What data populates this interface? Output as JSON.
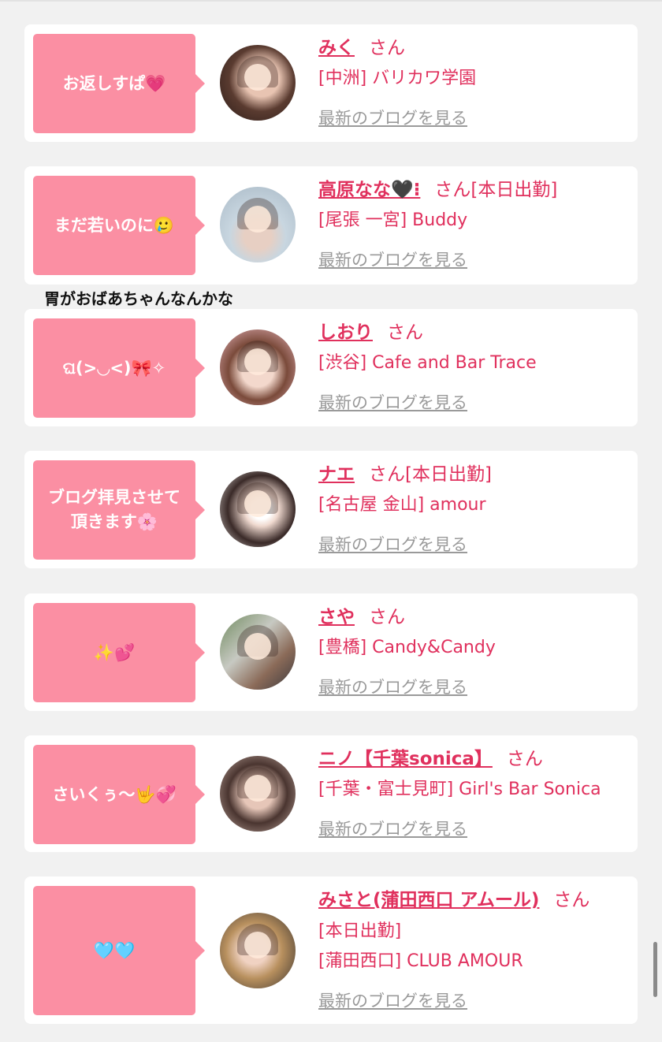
{
  "caption": "胃がおばあちゃんなんかな",
  "blog_link_label": "最新のブログを見る",
  "san_label": "さん",
  "colors": {
    "bubble": "#fb8fa3",
    "accent": "#e0305d",
    "link": "#9a9a9a",
    "background": "#f1f1f1"
  },
  "cards": [
    {
      "bubble": "お返しすぱ💗",
      "name": "みく",
      "suffix": "",
      "line1": "[中洲] バリカワ学園",
      "line2": "",
      "avatar": "portrait-with-glasses"
    },
    {
      "bubble": "まだ若いのに🥲",
      "name": "高原なな🖤⁝",
      "suffix": "[本日出勤]",
      "line1": "[尾張 一宮] Buddy",
      "line2": "",
      "avatar": "portrait-window"
    },
    {
      "bubble": "ଘ(>◡<)🎀✧",
      "name": "しおり",
      "suffix": "",
      "line1": "[渋谷] Cafe and Bar Trace",
      "line2": "",
      "avatar": "portrait-hearts"
    },
    {
      "bubble": "ブログ拝見させて\n頂きます🌸",
      "name": "ナエ",
      "suffix": "[本日出勤]",
      "line1": "[名古屋 金山] amour",
      "line2": "",
      "avatar": "portrait-sticker"
    },
    {
      "bubble": "✨💕",
      "name": "さや",
      "suffix": "",
      "line1": "[豊橋] Candy&Candy",
      "line2": "",
      "avatar": "portrait-window-seat"
    },
    {
      "bubble": "さいくぅ〜🤟💞",
      "name": "ニノ【千葉sonica】",
      "suffix": "",
      "line1": "[千葉・富士見町] Girl's Bar Sonica",
      "line2": "",
      "avatar": "portrait-blurred"
    },
    {
      "bubble": "🩵🩵",
      "name": "みさと(蒲田西口 アムール)",
      "suffix": "",
      "line1": "[本日出勤]",
      "line2": "[蒲田西口] CLUB AMOUR",
      "avatar": "portrait-hair"
    }
  ]
}
